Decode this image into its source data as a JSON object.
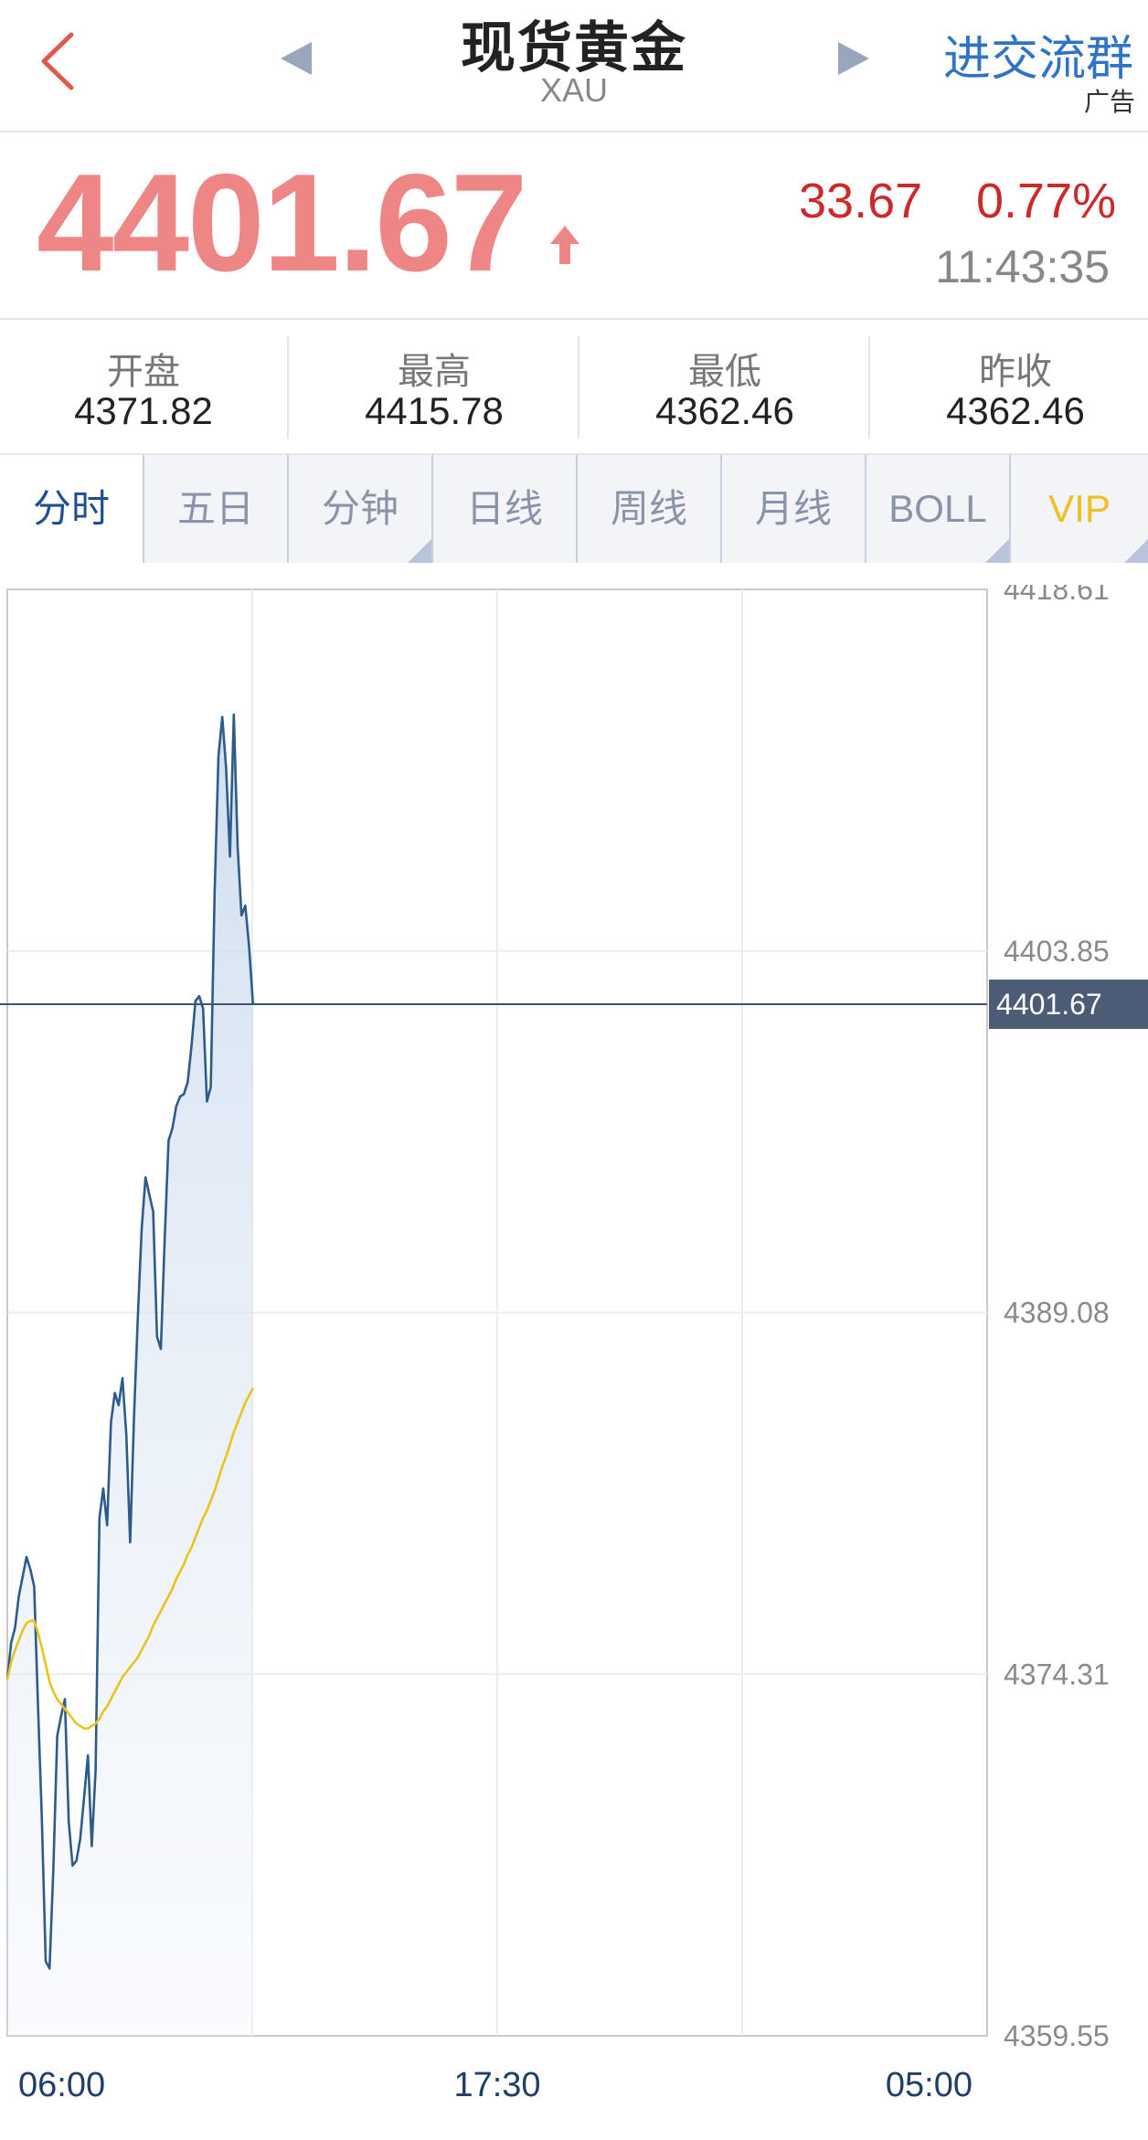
{
  "header": {
    "title": "现货黄金",
    "subtitle": "XAU",
    "join_label": "进交流群",
    "ad_label": "广告",
    "back_icon": "chevron-left-icon",
    "prev_icon": "triangle-left-icon",
    "next_icon": "triangle-right-icon"
  },
  "quote": {
    "price": "4401.67",
    "change": "33.67",
    "change_pct": "0.77%",
    "time": "11:43:35",
    "trend_icon": "arrow-up-icon",
    "up_color": "#cc2a2a"
  },
  "stats": [
    {
      "label": "开盘",
      "value": "4371.82"
    },
    {
      "label": "最高",
      "value": "4415.78"
    },
    {
      "label": "最低",
      "value": "4362.46"
    },
    {
      "label": "昨收",
      "value": "4362.46"
    }
  ],
  "tabs": [
    {
      "label": "分时",
      "active": true
    },
    {
      "label": "五日"
    },
    {
      "label": "分钟",
      "dropdown": true
    },
    {
      "label": "日线"
    },
    {
      "label": "周线"
    },
    {
      "label": "月线"
    },
    {
      "label": "BOLL",
      "dropdown": true
    },
    {
      "label": "VIP",
      "dropdown": true
    }
  ],
  "chart_data": {
    "type": "line",
    "y_ticks": [
      "4418.61",
      "4403.85",
      "4389.08",
      "4374.31",
      "4359.55"
    ],
    "ylim": [
      4359.55,
      4418.61
    ],
    "x_ticks": [
      "06:00",
      "17:30",
      "05:00"
    ],
    "current_label": "4401.67",
    "current_value": 4401.67,
    "colors": {
      "price": "#2d5b8a",
      "average": "#e8c41e",
      "current_line": "#3d5370"
    },
    "price": [
      4374.1,
      4375.6,
      4376.2,
      4377.5,
      4378.3,
      4379.1,
      4378.6,
      4377.9,
      4373.0,
      4368.4,
      4362.6,
      4362.3,
      4366.4,
      4371.8,
      4372.6,
      4373.3,
      4368.3,
      4366.5,
      4366.7,
      4367.6,
      4369.3,
      4371.0,
      4367.3,
      4370.4,
      4380.7,
      4381.9,
      4380.4,
      4384.6,
      4385.8,
      4385.3,
      4386.4,
      4384.1,
      4379.7,
      4384.8,
      4388.9,
      4392.5,
      4394.6,
      4393.9,
      4393.2,
      4388.1,
      4387.6,
      4392.1,
      4396.1,
      4396.6,
      4397.5,
      4397.9,
      4398.0,
      4398.5,
      4400.0,
      4401.8,
      4402.0,
      4401.5,
      4397.7,
      4398.3,
      4406.2,
      4411.8,
      4413.4,
      4411.3,
      4407.7,
      4413.5,
      4408.1,
      4405.3,
      4405.7,
      4404.0,
      4401.67
    ],
    "average": [
      4374.1,
      4374.8,
      4375.3,
      4375.7,
      4376.1,
      4376.4,
      4376.5,
      4376.5,
      4376.0,
      4375.4,
      4374.7,
      4374.0,
      4373.6,
      4373.3,
      4373.1,
      4372.9,
      4372.7,
      4372.5,
      4372.3,
      4372.2,
      4372.1,
      4372.1,
      4372.2,
      4372.3,
      4372.5,
      4372.8,
      4373.0,
      4373.3,
      4373.6,
      4373.9,
      4374.2,
      4374.4,
      4374.6,
      4374.8,
      4375.0,
      4375.3,
      4375.6,
      4375.9,
      4376.3,
      4376.6,
      4376.9,
      4377.2,
      4377.5,
      4377.8,
      4378.2,
      4378.5,
      4378.8,
      4379.2,
      4379.5,
      4379.9,
      4380.3,
      4380.7,
      4381.0,
      4381.4,
      4381.8,
      4382.3,
      4382.8,
      4383.2,
      4383.7,
      4384.2,
      4384.6,
      4385.0,
      4385.4,
      4385.7,
      4386.0
    ]
  }
}
